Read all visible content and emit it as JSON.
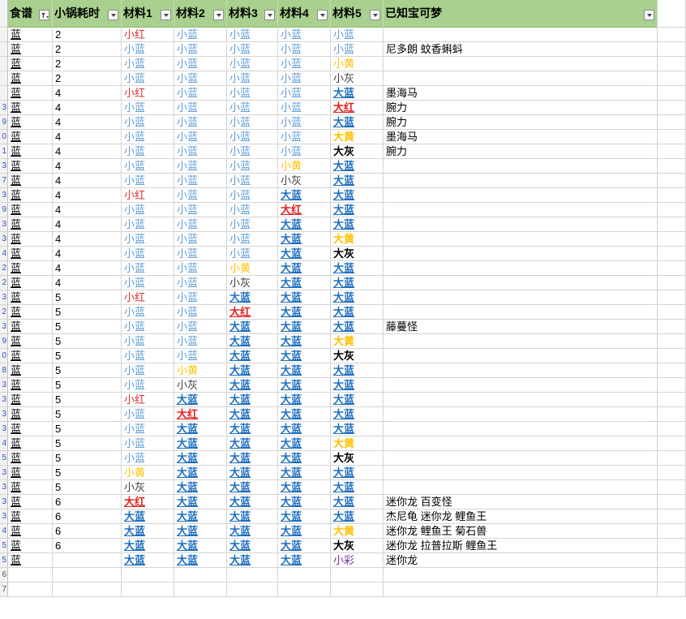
{
  "headers": [
    "食谱",
    "小锅耗时",
    "材料1",
    "材料2",
    "材料3",
    "材料4",
    "材料5",
    "已知宝可梦"
  ],
  "filtered_column_index": 0,
  "row_header_labels": [
    "",
    "",
    "",
    "",
    "",
    "3",
    "9",
    "0",
    "1",
    "3",
    "7",
    "3",
    "9",
    "3",
    "3",
    "4",
    "2",
    "2",
    "3",
    "2",
    "3",
    "9",
    "0",
    "8",
    "3",
    "3",
    "3",
    "3",
    "4",
    "5",
    "3",
    "3",
    "3",
    "3",
    "4",
    "5",
    "5",
    "6",
    "7"
  ],
  "rows": [
    {
      "recipe": "蓝",
      "time": "2",
      "m": [
        "小红",
        "小蓝",
        "小蓝",
        "小蓝",
        "小蓝"
      ],
      "c": [
        "sr",
        "sb",
        "sb",
        "sb",
        "sb"
      ],
      "pokemon": ""
    },
    {
      "recipe": "蓝",
      "time": "2",
      "m": [
        "小蓝",
        "小蓝",
        "小蓝",
        "小蓝",
        "小蓝"
      ],
      "c": [
        "sb",
        "sb",
        "sb",
        "sb",
        "sb"
      ],
      "pokemon": "尼多朗 蚊香蝌蚪"
    },
    {
      "recipe": "蓝",
      "time": "2",
      "m": [
        "小蓝",
        "小蓝",
        "小蓝",
        "小蓝",
        "小黄"
      ],
      "c": [
        "sb",
        "sb",
        "sb",
        "sb",
        "sy"
      ],
      "pokemon": ""
    },
    {
      "recipe": "蓝",
      "time": "2",
      "m": [
        "小蓝",
        "小蓝",
        "小蓝",
        "小蓝",
        "小灰"
      ],
      "c": [
        "sb",
        "sb",
        "sb",
        "sb",
        "sg"
      ],
      "pokemon": ""
    },
    {
      "recipe": "蓝",
      "time": "4",
      "m": [
        "小红",
        "小蓝",
        "小蓝",
        "小蓝",
        "大蓝"
      ],
      "c": [
        "sr",
        "sb",
        "sb",
        "sb",
        "bb"
      ],
      "pokemon": "墨海马"
    },
    {
      "recipe": "蓝",
      "time": "4",
      "m": [
        "小蓝",
        "小蓝",
        "小蓝",
        "小蓝",
        "大红"
      ],
      "c": [
        "sb",
        "sb",
        "sb",
        "sb",
        "br"
      ],
      "pokemon": "腕力"
    },
    {
      "recipe": "蓝",
      "time": "4",
      "m": [
        "小蓝",
        "小蓝",
        "小蓝",
        "小蓝",
        "大蓝"
      ],
      "c": [
        "sb",
        "sb",
        "sb",
        "sb",
        "bb"
      ],
      "pokemon": "腕力"
    },
    {
      "recipe": "蓝",
      "time": "4",
      "m": [
        "小蓝",
        "小蓝",
        "小蓝",
        "小蓝",
        "大黄"
      ],
      "c": [
        "sb",
        "sb",
        "sb",
        "sb",
        "by"
      ],
      "pokemon": "墨海马"
    },
    {
      "recipe": "蓝",
      "time": "4",
      "m": [
        "小蓝",
        "小蓝",
        "小蓝",
        "小蓝",
        "大灰"
      ],
      "c": [
        "sb",
        "sb",
        "sb",
        "sb",
        "bg"
      ],
      "pokemon": "腕力"
    },
    {
      "recipe": "蓝",
      "time": "4",
      "m": [
        "小蓝",
        "小蓝",
        "小蓝",
        "小黄",
        "大蓝"
      ],
      "c": [
        "sb",
        "sb",
        "sb",
        "sy",
        "bb"
      ],
      "pokemon": ""
    },
    {
      "recipe": "蓝",
      "time": "4",
      "m": [
        "小蓝",
        "小蓝",
        "小蓝",
        "小灰",
        "大蓝"
      ],
      "c": [
        "sb",
        "sb",
        "sb",
        "sg",
        "bb"
      ],
      "pokemon": ""
    },
    {
      "recipe": "蓝",
      "time": "4",
      "m": [
        "小红",
        "小蓝",
        "小蓝",
        "大蓝",
        "大蓝"
      ],
      "c": [
        "sr",
        "sb",
        "sb",
        "bb",
        "bb"
      ],
      "pokemon": ""
    },
    {
      "recipe": "蓝",
      "time": "4",
      "m": [
        "小蓝",
        "小蓝",
        "小蓝",
        "大红",
        "大蓝"
      ],
      "c": [
        "sb",
        "sb",
        "sb",
        "br",
        "bb"
      ],
      "pokemon": ""
    },
    {
      "recipe": "蓝",
      "time": "4",
      "m": [
        "小蓝",
        "小蓝",
        "小蓝",
        "大蓝",
        "大蓝"
      ],
      "c": [
        "sb",
        "sb",
        "sb",
        "bb",
        "bb"
      ],
      "pokemon": ""
    },
    {
      "recipe": "蓝",
      "time": "4",
      "m": [
        "小蓝",
        "小蓝",
        "小蓝",
        "大蓝",
        "大黄"
      ],
      "c": [
        "sb",
        "sb",
        "sb",
        "bb",
        "by"
      ],
      "pokemon": ""
    },
    {
      "recipe": "蓝",
      "time": "4",
      "m": [
        "小蓝",
        "小蓝",
        "小蓝",
        "大蓝",
        "大灰"
      ],
      "c": [
        "sb",
        "sb",
        "sb",
        "bb",
        "bg"
      ],
      "pokemon": ""
    },
    {
      "recipe": "蓝",
      "time": "4",
      "m": [
        "小蓝",
        "小蓝",
        "小黄",
        "大蓝",
        "大蓝"
      ],
      "c": [
        "sb",
        "sb",
        "sy",
        "bb",
        "bb"
      ],
      "pokemon": ""
    },
    {
      "recipe": "蓝",
      "time": "4",
      "m": [
        "小蓝",
        "小蓝",
        "小灰",
        "大蓝",
        "大蓝"
      ],
      "c": [
        "sb",
        "sb",
        "sg",
        "bb",
        "bb"
      ],
      "pokemon": ""
    },
    {
      "recipe": "蓝",
      "time": "5",
      "m": [
        "小红",
        "小蓝",
        "大蓝",
        "大蓝",
        "大蓝"
      ],
      "c": [
        "sr",
        "sb",
        "bb",
        "bb",
        "bb"
      ],
      "pokemon": ""
    },
    {
      "recipe": "蓝",
      "time": "5",
      "m": [
        "小蓝",
        "小蓝",
        "大红",
        "大蓝",
        "大蓝"
      ],
      "c": [
        "sb",
        "sb",
        "br",
        "bb",
        "bb"
      ],
      "pokemon": ""
    },
    {
      "recipe": "蓝",
      "time": "5",
      "m": [
        "小蓝",
        "小蓝",
        "大蓝",
        "大蓝",
        "大蓝"
      ],
      "c": [
        "sb",
        "sb",
        "bb",
        "bb",
        "bb"
      ],
      "pokemon": "藤蔓怪"
    },
    {
      "recipe": "蓝",
      "time": "5",
      "m": [
        "小蓝",
        "小蓝",
        "大蓝",
        "大蓝",
        "大黄"
      ],
      "c": [
        "sb",
        "sb",
        "bb",
        "bb",
        "by"
      ],
      "pokemon": ""
    },
    {
      "recipe": "蓝",
      "time": "5",
      "m": [
        "小蓝",
        "小蓝",
        "大蓝",
        "大蓝",
        "大灰"
      ],
      "c": [
        "sb",
        "sb",
        "bb",
        "bb",
        "bg"
      ],
      "pokemon": ""
    },
    {
      "recipe": "蓝",
      "time": "5",
      "m": [
        "小蓝",
        "小黄",
        "大蓝",
        "大蓝",
        "大蓝"
      ],
      "c": [
        "sb",
        "sy",
        "bb",
        "bb",
        "bb"
      ],
      "pokemon": ""
    },
    {
      "recipe": "蓝",
      "time": "5",
      "m": [
        "小蓝",
        "小灰",
        "大蓝",
        "大蓝",
        "大蓝"
      ],
      "c": [
        "sb",
        "sg",
        "bb",
        "bb",
        "bb"
      ],
      "pokemon": ""
    },
    {
      "recipe": "蓝",
      "time": "5",
      "m": [
        "小红",
        "大蓝",
        "大蓝",
        "大蓝",
        "大蓝"
      ],
      "c": [
        "sr",
        "bb",
        "bb",
        "bb",
        "bb"
      ],
      "pokemon": ""
    },
    {
      "recipe": "蓝",
      "time": "5",
      "m": [
        "小蓝",
        "大红",
        "大蓝",
        "大蓝",
        "大蓝"
      ],
      "c": [
        "sb",
        "br",
        "bb",
        "bb",
        "bb"
      ],
      "pokemon": ""
    },
    {
      "recipe": "蓝",
      "time": "5",
      "m": [
        "小蓝",
        "大蓝",
        "大蓝",
        "大蓝",
        "大蓝"
      ],
      "c": [
        "sb",
        "bb",
        "bb",
        "bb",
        "bb"
      ],
      "pokemon": ""
    },
    {
      "recipe": "蓝",
      "time": "5",
      "m": [
        "小蓝",
        "大蓝",
        "大蓝",
        "大蓝",
        "大黄"
      ],
      "c": [
        "sb",
        "bb",
        "bb",
        "bb",
        "by"
      ],
      "pokemon": ""
    },
    {
      "recipe": "蓝",
      "time": "5",
      "m": [
        "小蓝",
        "大蓝",
        "大蓝",
        "大蓝",
        "大灰"
      ],
      "c": [
        "sb",
        "bb",
        "bb",
        "bb",
        "bg"
      ],
      "pokemon": ""
    },
    {
      "recipe": "蓝",
      "time": "5",
      "m": [
        "小黄",
        "大蓝",
        "大蓝",
        "大蓝",
        "大蓝"
      ],
      "c": [
        "sy",
        "bb",
        "bb",
        "bb",
        "bb"
      ],
      "pokemon": ""
    },
    {
      "recipe": "蓝",
      "time": "5",
      "m": [
        "小灰",
        "大蓝",
        "大蓝",
        "大蓝",
        "大蓝"
      ],
      "c": [
        "sg",
        "bb",
        "bb",
        "bb",
        "bb"
      ],
      "pokemon": ""
    },
    {
      "recipe": "蓝",
      "time": "6",
      "m": [
        "大红",
        "大蓝",
        "大蓝",
        "大蓝",
        "大蓝"
      ],
      "c": [
        "br",
        "bb",
        "bb",
        "bb",
        "bb"
      ],
      "pokemon": "迷你龙 百变怪"
    },
    {
      "recipe": "蓝",
      "time": "6",
      "m": [
        "大蓝",
        "大蓝",
        "大蓝",
        "大蓝",
        "大蓝"
      ],
      "c": [
        "bb",
        "bb",
        "bb",
        "bb",
        "bb"
      ],
      "pokemon": "杰尼龟 迷你龙 鲤鱼王"
    },
    {
      "recipe": "蓝",
      "time": "6",
      "m": [
        "大蓝",
        "大蓝",
        "大蓝",
        "大蓝",
        "大黄"
      ],
      "c": [
        "bb",
        "bb",
        "bb",
        "bb",
        "by"
      ],
      "pokemon": "迷你龙 鲤鱼王 菊石兽"
    },
    {
      "recipe": "蓝",
      "time": "6",
      "m": [
        "大蓝",
        "大蓝",
        "大蓝",
        "大蓝",
        "大灰"
      ],
      "c": [
        "bb",
        "bb",
        "bb",
        "bb",
        "bg"
      ],
      "pokemon": "迷你龙 拉普拉斯 鲤鱼王"
    },
    {
      "recipe": "蓝",
      "time": "",
      "m": [
        "大蓝",
        "大蓝",
        "大蓝",
        "大蓝",
        "小彩"
      ],
      "c": [
        "bb",
        "bb",
        "bb",
        "bb",
        "sp"
      ],
      "pokemon": "迷你龙"
    }
  ],
  "colors": {
    "header_bg": "#a9d08e",
    "small_blue": "#5b9bd5",
    "small_red": "#e03030",
    "small_yellow": "#ffc000",
    "small_gray": "#404040",
    "big_blue": "#1f6fc0",
    "big_red": "#e02020",
    "big_yellow": "#ffc000",
    "big_gray": "#000000",
    "small_rainbow": "#7030a0"
  },
  "icons": {
    "filter_dropdown": "chevron-down-icon",
    "filter_active": "funnel-icon"
  }
}
